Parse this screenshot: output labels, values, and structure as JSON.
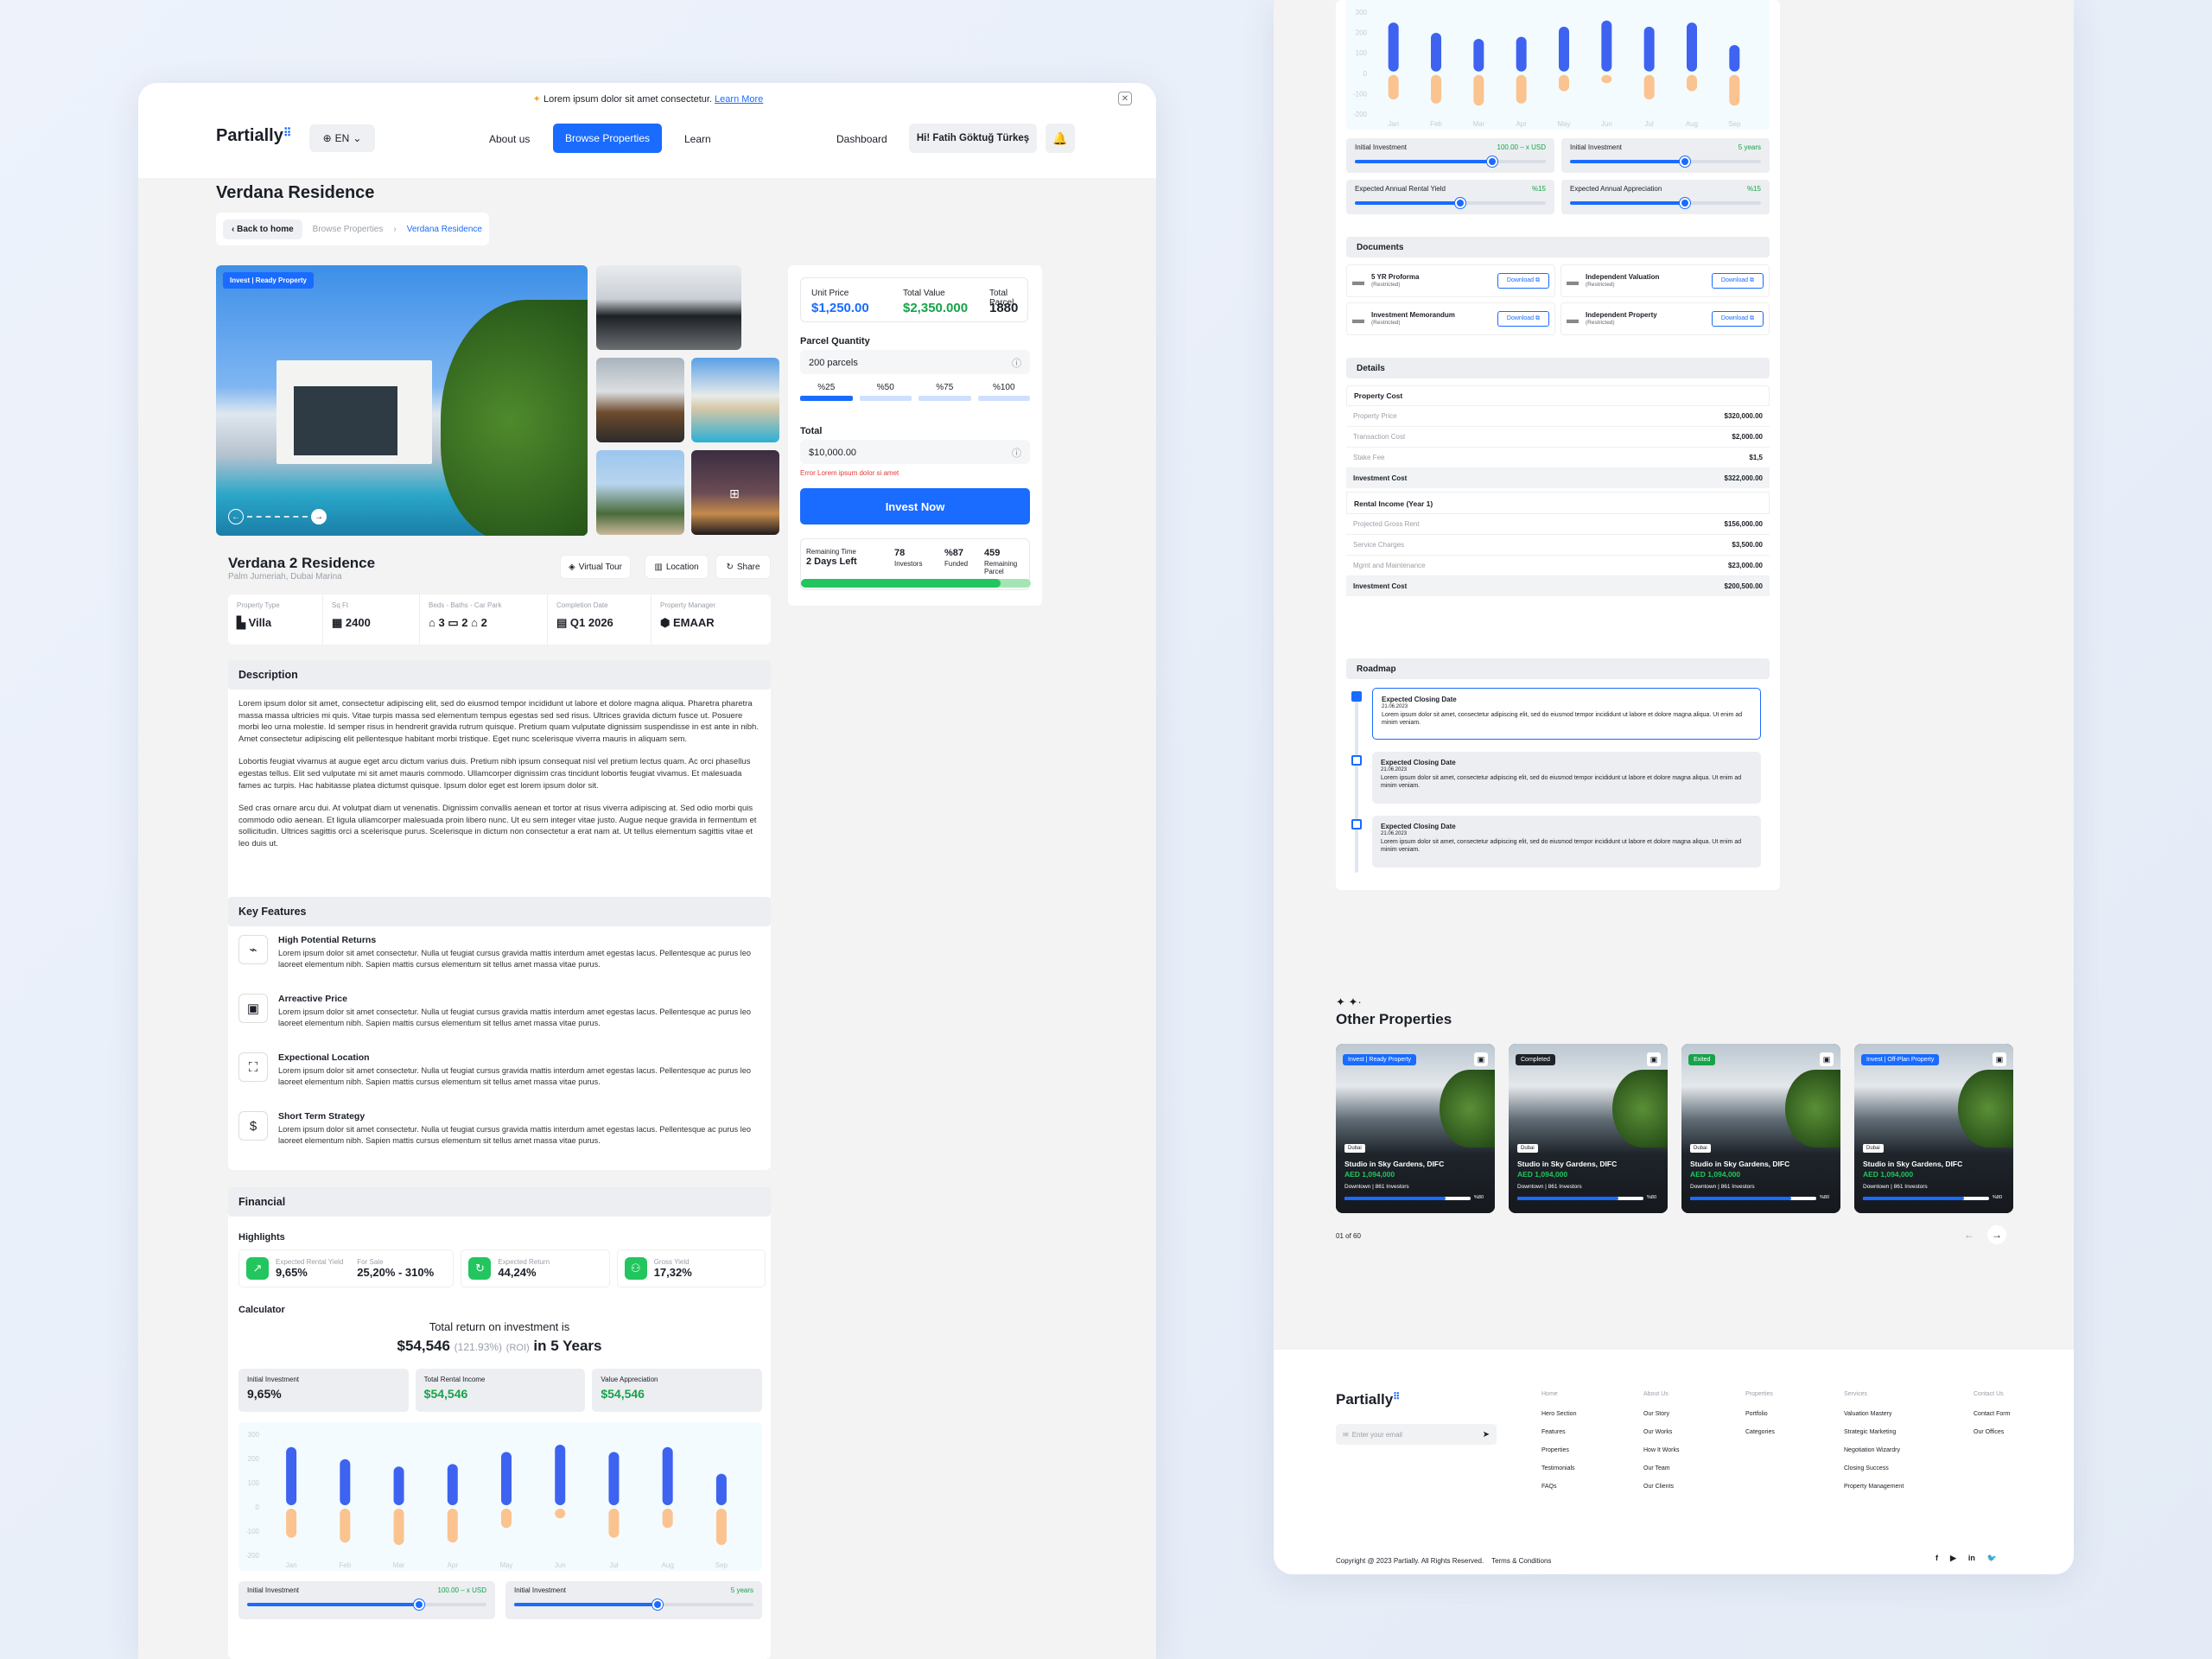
{
  "announcement": {
    "text": "Lorem ipsum dolor sit amet consectetur.",
    "link": "Learn More"
  },
  "brand": "Partially",
  "lang": "EN",
  "nav": {
    "about": "About us",
    "browse": "Browse Properties",
    "learn": "Learn",
    "dashboard": "Dashboard",
    "user": "Hi! Fatih Göktuğ Türkeş"
  },
  "page_title": "Verdana Residence",
  "breadcrumb": {
    "back": "Back to home",
    "parent": "Browse Properties",
    "current": "Verdana Residence"
  },
  "hero_badge": "Invest | Ready Property",
  "property": {
    "name": "Verdana 2 Residence",
    "location": "Palm Jumeriah, Dubai Marina"
  },
  "actions": {
    "tour": "Virtual Tour",
    "location": "Location",
    "share": "Share"
  },
  "specs": {
    "type_label": "Property Type",
    "type": "Villa",
    "sqft_label": "Sq Ft",
    "sqft": "2400",
    "rooms_label": "Beds - Baths - Car Park",
    "beds": "3",
    "baths": "2",
    "park": "2",
    "completion_label": "Completion Date",
    "completion": "Q1 2026",
    "manager_label": "Property Manager",
    "manager": "EMAAR"
  },
  "invest": {
    "unit_price_label": "Unit Price",
    "unit_price": "$1,250.00",
    "total_value_label": "Total Value",
    "total_value": "$2,350.000",
    "total_parcel_label": "Total Parcel",
    "total_parcel": "1880",
    "qty_label": "Parcel Quantity",
    "qty_value": "200 parcels",
    "presets": [
      "%25",
      "%50",
      "%75",
      "%100"
    ],
    "total_label": "Total",
    "total_value_input": "$10,000.00",
    "error": "Error Lorem ipsum dolor si amet",
    "cta": "Invest Now",
    "remaining_label": "Remaining Time",
    "remaining": "2 Days Left",
    "investors": "78",
    "investors_label": "Investors",
    "funded": "%87",
    "funded_label": "Funded",
    "remaining_parcel": "459",
    "remaining_parcel_label": "Remaining Parcel",
    "funded_progress": 0.87
  },
  "description": {
    "title": "Description",
    "p1": "Lorem ipsum dolor sit amet, consectetur adipiscing elit, sed do eiusmod tempor incididunt ut labore et dolore magna aliqua. Pharetra pharetra massa massa ultricies mi quis. Vitae turpis massa sed elementum tempus egestas sed sed risus. Ultrices gravida dictum fusce ut. Posuere morbi leo urna molestie. Id semper risus in hendrerit gravida rutrum quisque. Pretium quam vulputate dignissim suspendisse in est ante in nibh. Amet consectetur adipiscing elit pellentesque habitant morbi tristique. Eget nunc scelerisque viverra mauris in aliquam sem.",
    "p2": "Lobortis feugiat vivamus at augue eget arcu dictum varius duis. Pretium nibh ipsum consequat nisl vel pretium lectus quam. Ac orci phasellus egestas tellus. Elit sed vulputate mi sit amet mauris commodo. Ullamcorper dignissim cras tincidunt lobortis feugiat vivamus. Et malesuada fames ac turpis. Hac habitasse platea dictumst quisque. Ipsum dolor eget est lorem ipsum dolor sit.",
    "p3": "Sed cras ornare arcu dui. At volutpat diam ut venenatis. Dignissim convallis aenean et tortor at risus viverra adipiscing at. Sed odio morbi quis commodo odio aenean. Et ligula ullamcorper malesuada proin libero nunc. Ut eu sem integer vitae justo. Augue neque gravida in fermentum et sollicitudin. Ultrices sagittis orci a scelerisque purus. Scelerisque in dictum non consectetur a erat nam at. Ut tellus elementum sagittis vitae et leo duis ut."
  },
  "features": {
    "title": "Key Features",
    "items": [
      {
        "title": "High Potential Returns",
        "text": "Lorem ipsum dolor sit amet consectetur. Nulla ut feugiat cursus gravida mattis interdum amet egestas lacus. Pellentesque ac purus leo laoreet elementum nibh. Sapien mattis cursus elementum sit tellus amet massa vitae purus.",
        "icon": "chart-icon"
      },
      {
        "title": "Arreactive Price",
        "text": "Lorem ipsum dolor sit amet consectetur. Nulla ut feugiat cursus gravida mattis interdum amet egestas lacus. Pellentesque ac purus leo laoreet elementum nibh. Sapien mattis cursus elementum sit tellus amet massa vitae purus.",
        "icon": "cash-icon"
      },
      {
        "title": "Expectional Location",
        "text": "Lorem ipsum dolor sit amet consectetur. Nulla ut feugiat cursus gravida mattis interdum amet egestas lacus. Pellentesque ac purus leo laoreet elementum nibh. Sapien mattis cursus elementum sit tellus amet massa vitae purus.",
        "icon": "map-icon"
      },
      {
        "title": "Short Term Strategy",
        "text": "Lorem ipsum dolor sit amet consectetur. Nulla ut feugiat cursus gravida mattis interdum amet egestas lacus. Pellentesque ac purus leo laoreet elementum nibh. Sapien mattis cursus elementum sit tellus amet massa vitae purus.",
        "icon": "dollar-icon"
      }
    ]
  },
  "financial": {
    "title": "Financial",
    "highlights": "Highlights",
    "rental_yield_label": "Expected Rental Yield",
    "rental_yield": "9,65%",
    "for_sale_label": "For Sale",
    "for_sale": "25,20% - 310%",
    "return_label": "Expected Return",
    "return": "44,24%",
    "gross_label": "Gross Yield",
    "gross": "17,32%",
    "calculator": "Calculator",
    "roi_head": "Total return on investment is",
    "roi_amount": "$54,546",
    "roi_pct": "(121.93%)",
    "roi_tag": "(ROI)",
    "roi_years": "in 5 Years",
    "initial_label": "Initial Investment",
    "initial": "9,65%",
    "rental_label": "Total Rental Income",
    "rental": "$54,546",
    "appreciation_label": "Value Appreciation",
    "appreciation": "$54,546"
  },
  "sliders": {
    "initial_inv": "Initial Investment",
    "initial_inv_val": "100.00 – x USD",
    "initial_years": "Initial Investment",
    "initial_years_val": "5 years",
    "rental_yield": "Expected Annual Rental Yield",
    "rental_yield_val": "%15",
    "appreciation": "Expected Annual Appreciation",
    "appreciation_val": "%15",
    "pos_initial": 0.72,
    "pos_years": 0.6,
    "pos_yield": 0.55,
    "pos_appr": 0.6
  },
  "chart_data": {
    "type": "bar",
    "categories": [
      "Jan",
      "Feb",
      "Mar",
      "Apr",
      "May",
      "Jun",
      "Jul",
      "Aug",
      "Sep"
    ],
    "yticks": [
      "300",
      "200",
      "100",
      "0",
      "-100",
      "-200"
    ],
    "ylim": [
      -200,
      300
    ],
    "series": [
      {
        "values": [
          240,
          190,
          160,
          170,
          220,
          250,
          220,
          240,
          130
        ],
        "color": "#3d63f0"
      },
      {
        "values": [
          -120,
          -140,
          -150,
          -140,
          -80,
          -40,
          -120,
          -80,
          -150
        ],
        "color": "#fbc38f"
      }
    ]
  },
  "documents": {
    "title": "Documents",
    "download": "Download",
    "items": [
      {
        "name": "5 YR Proforma",
        "note": "(Restricted)"
      },
      {
        "name": "Independent Valuation",
        "note": "(Restricted)"
      },
      {
        "name": "Investment Memorandum",
        "note": "(Restricted)"
      },
      {
        "name": "Independent Property",
        "note": "(Restricted)"
      }
    ]
  },
  "details": {
    "title": "Details",
    "cost_title": "Property Cost",
    "cost_rows": [
      [
        "Property Price",
        "$320,000.00"
      ],
      [
        "Transaction Cost",
        "$2,000.00"
      ],
      [
        "Stake Fee",
        "$1,5"
      ]
    ],
    "cost_total": [
      "Investment Cost",
      "$322,000.00"
    ],
    "rental_title": "Rental Income (Year 1)",
    "rental_rows": [
      [
        "Projected Gross Rent",
        "$156,000.00"
      ],
      [
        "Service Charges",
        "$3,500.00"
      ],
      [
        "Mgmt and Maintenance",
        "$23,000.00"
      ]
    ],
    "rental_total": [
      "Investment Cost",
      "$200,500.00"
    ]
  },
  "roadmap": {
    "title": "Roadmap",
    "items": [
      {
        "title": "Expected Closing Date",
        "date": "21.06.2023",
        "text": "Lorem ipsum dolor sit amet, consectetur adipiscing elit, sed do eiusmod tempor incididunt ut labore et dolore magna aliqua. Ut enim ad minim veniam."
      },
      {
        "title": "Expected Closing Date",
        "date": "21.06.2023",
        "text": "Lorem ipsum dolor sit amet, consectetur adipiscing elit, sed do eiusmod tempor incididunt ut labore et dolore magna aliqua. Ut enim ad minim veniam."
      },
      {
        "title": "Expected Closing Date",
        "date": "21.06.2023",
        "text": "Lorem ipsum dolor sit amet, consectetur adipiscing elit, sed do eiusmod tempor incididunt ut labore et dolore magna aliqua. Ut enim ad minim veniam."
      }
    ]
  },
  "other": {
    "title": "Other Properties",
    "pager": "01 of 60",
    "cards": [
      {
        "badge": "Invest | Ready Property",
        "badge_color": "#1a6bff",
        "city": "Dubai",
        "name": "Studio in Sky Gardens, DIFC",
        "price": "AED 1,094,000",
        "meta": "Downtown | 861 Investors",
        "pct": "%80",
        "progress": 0.8
      },
      {
        "badge": "Completed",
        "badge_color": "#1f2329",
        "city": "Dubai",
        "name": "Studio in Sky Gardens, DIFC",
        "price": "AED 1,094,000",
        "meta": "Downtown | 861 Investors",
        "pct": "%80",
        "progress": 0.8
      },
      {
        "badge": "Exited",
        "badge_color": "#16a34a",
        "city": "Dubai",
        "name": "Studio in Sky Gardens, DIFC",
        "price": "AED 1,094,000",
        "meta": "Downtown | 861 Investors",
        "pct": "%80",
        "progress": 0.8
      },
      {
        "badge": "Invest | Off-Plan Property",
        "badge_color": "#1a6bff",
        "city": "Dubai",
        "name": "Studio in Sky Gardens, DIFC",
        "price": "AED 1,094,000",
        "meta": "Downtown | 861 Investors",
        "pct": "%80",
        "progress": 0.8
      }
    ]
  },
  "footer": {
    "email_placeholder": "Enter your email",
    "cols": [
      {
        "head": "Home",
        "links": [
          "Hero Section",
          "Features",
          "Properties",
          "Testimonials",
          "FAQs"
        ]
      },
      {
        "head": "About Us",
        "links": [
          "Our Story",
          "Our Works",
          "How It Works",
          "Our Team",
          "Our Clients"
        ]
      },
      {
        "head": "Properties",
        "links": [
          "Portfolio",
          "Categories"
        ]
      },
      {
        "head": "Services",
        "links": [
          "Valuation Mastery",
          "Strategic Marketing",
          "Negotiation Wizardry",
          "Closing Success",
          "Property Management"
        ]
      },
      {
        "head": "Contact Us",
        "links": [
          "Contact Form",
          "Our Offices"
        ]
      }
    ],
    "copyright": "Copyright @ 2023 Partially. All Rights Reserved.",
    "terms": "Terms & Conditions"
  }
}
